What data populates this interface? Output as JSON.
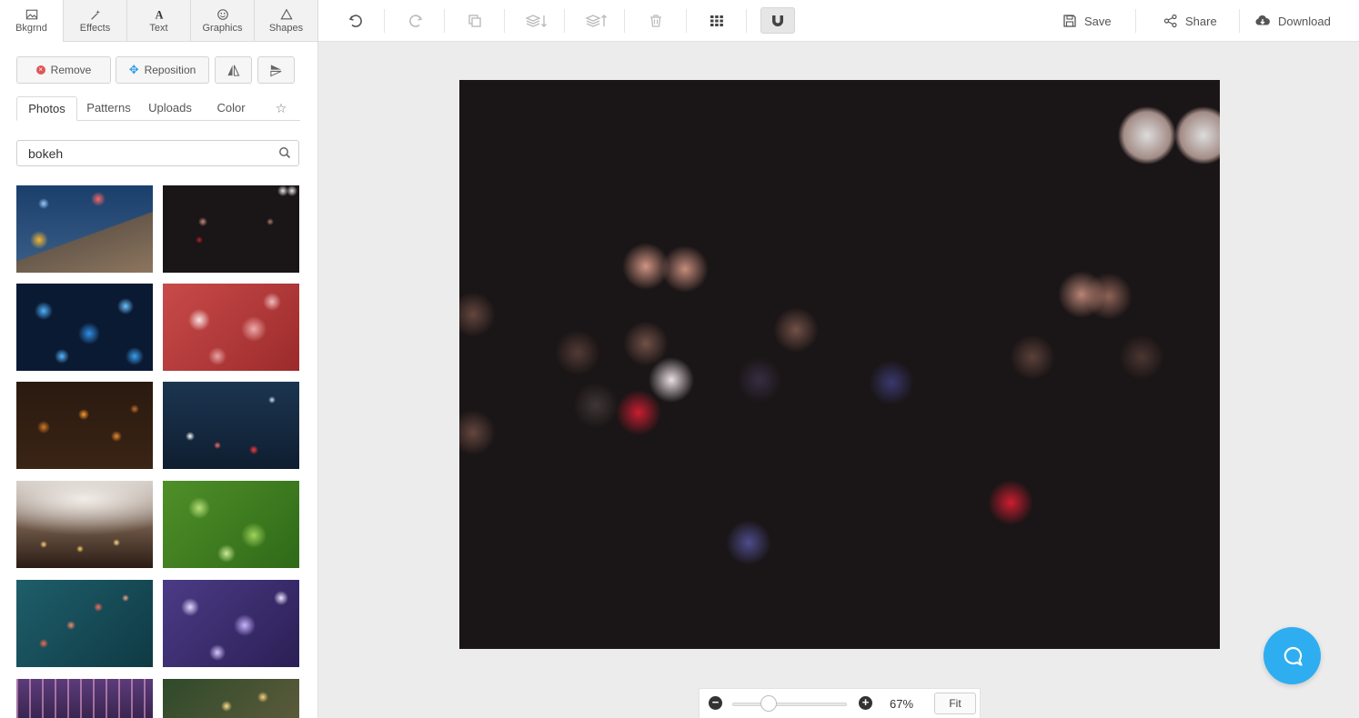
{
  "tool_tabs": [
    {
      "label": "Bkgrnd",
      "icon": "image-icon",
      "active": true
    },
    {
      "label": "Effects",
      "icon": "magic-wand-icon"
    },
    {
      "label": "Text",
      "icon": "text-icon"
    },
    {
      "label": "Graphics",
      "icon": "smiley-icon"
    },
    {
      "label": "Shapes",
      "icon": "triangle-icon"
    }
  ],
  "toolbar": {
    "save_label": "Save",
    "share_label": "Share",
    "download_label": "Download"
  },
  "sidebar": {
    "remove_label": "Remove",
    "reposition_label": "Reposition",
    "subtabs": [
      "Photos",
      "Patterns",
      "Uploads",
      "Color"
    ],
    "search_value": "bokeh"
  },
  "zoom": {
    "percent_label": "67%",
    "level": 0.32,
    "fit_label": "Fit"
  },
  "colors": {
    "accent": "#2eaef0",
    "canvas_bg": "#1a1516"
  }
}
